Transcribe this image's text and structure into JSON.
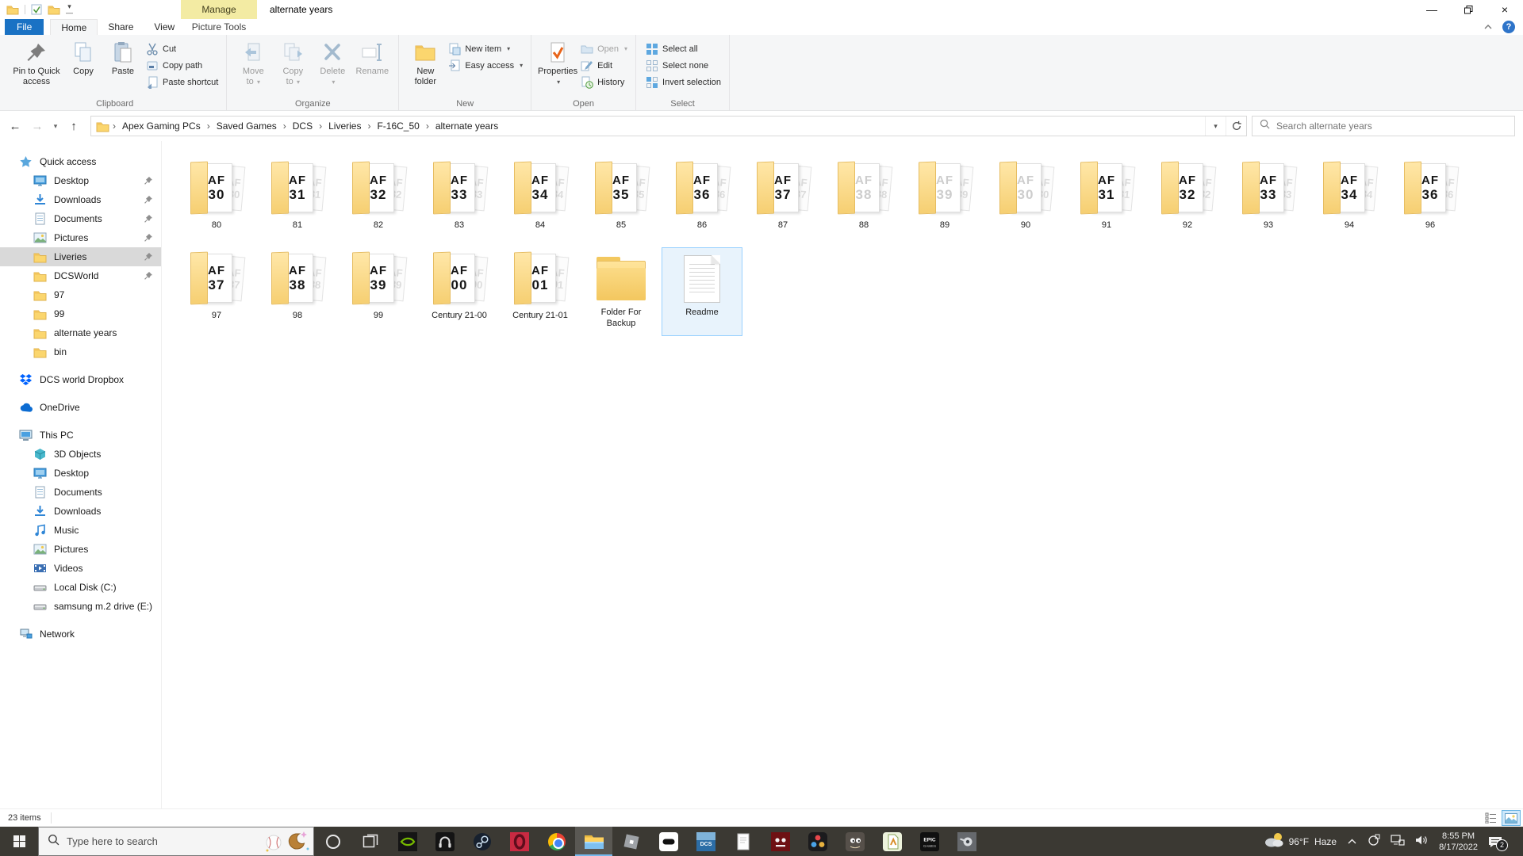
{
  "titlebar": {
    "contextual_header": "Manage",
    "title": "alternate years"
  },
  "tabs": [
    {
      "label": "File",
      "kind": "file"
    },
    {
      "label": "Home",
      "kind": "active"
    },
    {
      "label": "Share",
      "kind": "normal"
    },
    {
      "label": "View",
      "kind": "normal"
    },
    {
      "label": "Picture Tools",
      "kind": "contextual"
    }
  ],
  "ribbon": {
    "groups": [
      {
        "label": "Clipboard",
        "large": [
          {
            "label": "Pin to Quick access",
            "lines": [
              "Pin to Quick",
              "access"
            ],
            "icon": "pin",
            "wide": true
          },
          {
            "label": "Copy",
            "lines": [
              "Copy"
            ],
            "icon": "copy"
          },
          {
            "label": "Paste",
            "lines": [
              "Paste"
            ],
            "icon": "paste"
          }
        ],
        "small": [
          {
            "label": "Cut",
            "icon": "cut"
          },
          {
            "label": "Copy path",
            "icon": "copy-path"
          },
          {
            "label": "Paste shortcut",
            "icon": "paste-shortcut"
          }
        ]
      },
      {
        "label": "Organize",
        "large": [
          {
            "label": "Move to",
            "lines": [
              "Move",
              "to"
            ],
            "icon": "move-to",
            "dropdown": true,
            "disabled": true
          },
          {
            "label": "Copy to",
            "lines": [
              "Copy",
              "to"
            ],
            "icon": "copy-to",
            "dropdown": true,
            "disabled": true
          },
          {
            "label": "Delete",
            "lines": [
              "Delete"
            ],
            "icon": "delete",
            "dropdown": true,
            "disabled": true
          },
          {
            "label": "Rename",
            "lines": [
              "Rename"
            ],
            "icon": "rename",
            "disabled": true
          }
        ],
        "small": []
      },
      {
        "label": "New",
        "large": [
          {
            "label": "New folder",
            "lines": [
              "New",
              "folder"
            ],
            "icon": "new-folder"
          }
        ],
        "small": [
          {
            "label": "New item",
            "icon": "new-item",
            "dropdown": true
          },
          {
            "label": "Easy access",
            "icon": "easy-access",
            "dropdown": true
          }
        ]
      },
      {
        "label": "Open",
        "large": [
          {
            "label": "Properties",
            "lines": [
              "Properties"
            ],
            "icon": "properties",
            "dropdown": true
          }
        ],
        "small": [
          {
            "label": "Open",
            "icon": "open",
            "dropdown": true,
            "disabled": true
          },
          {
            "label": "Edit",
            "icon": "edit"
          },
          {
            "label": "History",
            "icon": "history"
          }
        ]
      },
      {
        "label": "Select",
        "large": [],
        "small": [
          {
            "label": "Select all",
            "icon": "select-all"
          },
          {
            "label": "Select none",
            "icon": "select-none"
          },
          {
            "label": "Invert selection",
            "icon": "invert-selection"
          }
        ]
      }
    ]
  },
  "addressbar": {
    "breadcrumb": [
      "Apex Gaming PCs",
      "Saved Games",
      "DCS",
      "Liveries",
      "F-16C_50",
      "alternate years"
    ],
    "search_placeholder": "Search alternate years"
  },
  "sidebar": {
    "sections": [
      {
        "label": "Quick access",
        "icon": "star",
        "children": [
          {
            "label": "Desktop",
            "icon": "desktop",
            "pinned": true
          },
          {
            "label": "Downloads",
            "icon": "downloads",
            "pinned": true
          },
          {
            "label": "Documents",
            "icon": "documents",
            "pinned": true
          },
          {
            "label": "Pictures",
            "icon": "pictures",
            "pinned": true
          },
          {
            "label": "Liveries",
            "icon": "folder",
            "pinned": true,
            "selected": true
          },
          {
            "label": "DCSWorld",
            "icon": "folder",
            "pinned": true
          },
          {
            "label": "97",
            "icon": "folder"
          },
          {
            "label": "99",
            "icon": "folder"
          },
          {
            "label": "alternate years",
            "icon": "folder"
          },
          {
            "label": "bin",
            "icon": "folder"
          }
        ]
      },
      {
        "label": "DCS world Dropbox",
        "icon": "dropbox",
        "children": []
      },
      {
        "label": "OneDrive",
        "icon": "onedrive",
        "children": []
      },
      {
        "label": "This PC",
        "icon": "computer",
        "children": [
          {
            "label": "3D Objects",
            "icon": "cube"
          },
          {
            "label": "Desktop",
            "icon": "desktop"
          },
          {
            "label": "Documents",
            "icon": "documents"
          },
          {
            "label": "Downloads",
            "icon": "downloads"
          },
          {
            "label": "Music",
            "icon": "music"
          },
          {
            "label": "Pictures",
            "icon": "pictures"
          },
          {
            "label": "Videos",
            "icon": "videos"
          },
          {
            "label": "Local Disk (C:)",
            "icon": "disk"
          },
          {
            "label": "samsung m.2 drive (E:)",
            "icon": "disk"
          }
        ]
      },
      {
        "label": "Network",
        "icon": "network",
        "children": []
      }
    ]
  },
  "content": {
    "preview_prefix": "AF",
    "items": [
      {
        "label": "80",
        "type": "preview-folder",
        "preview": "30"
      },
      {
        "label": "81",
        "type": "preview-folder",
        "preview": "31"
      },
      {
        "label": "82",
        "type": "preview-folder",
        "preview": "32"
      },
      {
        "label": "83",
        "type": "preview-folder",
        "preview": "33"
      },
      {
        "label": "84",
        "type": "preview-folder",
        "preview": "34"
      },
      {
        "label": "85",
        "type": "preview-folder",
        "preview": "35"
      },
      {
        "label": "86",
        "type": "preview-folder",
        "preview": "36"
      },
      {
        "label": "87",
        "type": "preview-folder",
        "preview": "37"
      },
      {
        "label": "88",
        "type": "preview-folder",
        "preview": "38",
        "faded": true
      },
      {
        "label": "89",
        "type": "preview-folder",
        "preview": "39",
        "faded": true
      },
      {
        "label": "90",
        "type": "preview-folder",
        "preview": "30",
        "faded": true
      },
      {
        "label": "91",
        "type": "preview-folder",
        "preview": "31"
      },
      {
        "label": "92",
        "type": "preview-folder",
        "preview": "32"
      },
      {
        "label": "93",
        "type": "preview-folder",
        "preview": "33"
      },
      {
        "label": "94",
        "type": "preview-folder",
        "preview": "34"
      },
      {
        "label": "96",
        "type": "preview-folder",
        "preview": "36"
      },
      {
        "label": "97",
        "type": "preview-folder",
        "preview": "37"
      },
      {
        "label": "98",
        "type": "preview-folder",
        "preview": "38"
      },
      {
        "label": "99",
        "type": "preview-folder",
        "preview": "39"
      },
      {
        "label": "Century 21-00",
        "type": "preview-folder",
        "preview": "00"
      },
      {
        "label": "Century 21-01",
        "type": "preview-folder",
        "preview": "01"
      },
      {
        "label": "Folder For Backup",
        "type": "folder"
      },
      {
        "label": "Readme",
        "type": "document",
        "selected": true
      }
    ]
  },
  "statusbar": {
    "count": "23 items"
  },
  "taskbar": {
    "search_placeholder": "Type here to search",
    "apps": [
      {
        "name": "cortana"
      },
      {
        "name": "task-view"
      },
      {
        "name": "nvidia"
      },
      {
        "name": "headset-app"
      },
      {
        "name": "steam"
      },
      {
        "name": "opera-gx"
      },
      {
        "name": "chrome"
      },
      {
        "name": "file-explorer",
        "active": true
      },
      {
        "name": "roblox"
      },
      {
        "name": "oculus"
      },
      {
        "name": "dcs",
        "glyph_text": "DCS"
      },
      {
        "name": "notepad"
      },
      {
        "name": "fnaf"
      },
      {
        "name": "davinci-resolve"
      },
      {
        "name": "gimp"
      },
      {
        "name": "notepad-plus"
      },
      {
        "name": "epic-games",
        "glyph_text": "EPIC"
      },
      {
        "name": "3d-app"
      }
    ],
    "tray": {
      "weather_temp": "96°F",
      "weather_cond": "Haze",
      "time": "8:55 PM",
      "date": "8/17/2022",
      "badge": "2"
    }
  }
}
